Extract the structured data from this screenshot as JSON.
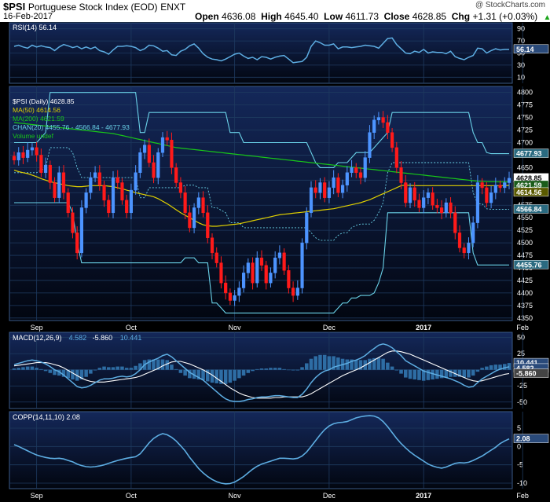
{
  "header": {
    "symbol": "$PSI",
    "name": "Portuguese Stock Index (EOD)",
    "exchange": "ENXT",
    "date": "16-Feb-2017",
    "watermark": "@ StockCharts.com",
    "open_label": "Open",
    "open": "4636.08",
    "high_label": "High",
    "high": "4645.40",
    "low_label": "Low",
    "low": "4611.73",
    "close_label": "Close",
    "close": "4628.85",
    "chg_label": "Chg",
    "chg": "+1.31 (+0.03%)"
  },
  "colors": {
    "background": "#000000",
    "panel": "#0a1433",
    "grid": "#1e3a5f",
    "up": "#4d94ff",
    "down": "#ff1a1a",
    "ma50": "#e0d000",
    "ma200": "#18c818",
    "channel": "#6ad2e8",
    "indicator": "#5dade2",
    "signal": "#ffffff"
  },
  "chart_data": [
    {
      "type": "line",
      "panel": "RSI",
      "legend": "RSI(14) 56.14",
      "y_ticks": [
        90,
        70,
        50,
        30,
        10
      ],
      "ylim": [
        0,
        100
      ],
      "last_value": "56.14",
      "values": [
        61,
        63,
        60,
        58,
        63,
        60,
        62,
        60,
        59,
        54,
        60,
        64,
        62,
        59,
        61,
        57,
        60,
        57,
        60,
        54,
        52,
        48,
        55,
        61,
        61,
        62,
        61,
        59,
        54,
        57,
        63,
        62,
        58,
        53,
        54,
        47,
        46,
        53,
        56,
        62,
        65,
        58,
        49,
        43,
        40,
        39,
        37,
        40,
        44,
        48,
        50,
        45,
        41,
        43,
        39,
        44,
        43,
        40,
        43,
        45,
        46,
        40,
        34,
        35,
        36,
        43,
        61,
        70,
        67,
        63,
        63,
        65,
        57,
        60,
        60,
        59,
        60,
        61,
        63,
        62,
        61,
        58,
        66,
        74,
        75,
        64,
        57,
        50,
        49,
        53,
        51,
        56,
        50,
        52,
        51,
        51,
        49,
        53,
        44,
        41,
        39,
        43,
        46,
        58,
        57,
        50,
        54,
        57,
        55,
        56,
        56
      ]
    },
    {
      "type": "candlestick",
      "panel": "price",
      "legend": [
        {
          "text": "$PSI (Daily) 4628.85",
          "color": "#ffffff"
        },
        {
          "text": "MA(50) 4614.56",
          "color": "#e0d000"
        },
        {
          "text": "MA(200) 4621.59",
          "color": "#18c818"
        },
        {
          "text": "CHAN(20) 4455.76 - 4566.84 - 4677.93",
          "color": "#6ad2e8"
        },
        {
          "text": "Volume undef",
          "color": "#18c818"
        }
      ],
      "y_ticks": [
        4800,
        4775,
        4750,
        4725,
        4700,
        4675,
        4650,
        4625,
        4600,
        4575,
        4550,
        4525,
        4500,
        4475,
        4450,
        4425,
        4400,
        4375,
        4350
      ],
      "ylim": [
        4345,
        4812
      ],
      "last_labels": [
        {
          "text": "4628.85",
          "value": 4628.85
        },
        {
          "text": "4621.59",
          "value": 4621.59
        },
        {
          "text": "4614.56",
          "value": 4614.56
        },
        {
          "text": "4677.93",
          "value": 4677.93
        },
        {
          "text": "4566.84",
          "value": 4566.84
        },
        {
          "text": "4455.76",
          "value": 4455.76
        }
      ],
      "x_labels": [
        {
          "label": "Sep",
          "index": 5
        },
        {
          "label": "Oct",
          "index": 26
        },
        {
          "label": "Nov",
          "index": 49
        },
        {
          "label": "Dec",
          "index": 70
        },
        {
          "label": "2017",
          "index": 91
        },
        {
          "label": "Feb",
          "index": 113
        }
      ],
      "close": [
        4665,
        4680,
        4670,
        4685,
        4690,
        4675,
        4640,
        4655,
        4620,
        4590,
        4640,
        4600,
        4560,
        4520,
        4480,
        4570,
        4600,
        4630,
        4640,
        4615,
        4585,
        4560,
        4630,
        4620,
        4585,
        4560,
        4605,
        4640,
        4680,
        4695,
        4660,
        4630,
        4680,
        4710,
        4705,
        4650,
        4620,
        4600,
        4560,
        4530,
        4570,
        4590,
        4560,
        4510,
        4480,
        4460,
        4420,
        4400,
        4385,
        4395,
        4410,
        4440,
        4460,
        4420,
        4470,
        4455,
        4420,
        4440,
        4470,
        4480,
        4445,
        4410,
        4395,
        4410,
        4500,
        4560,
        4610,
        4600,
        4620,
        4590,
        4610,
        4630,
        4600,
        4615,
        4640,
        4650,
        4640,
        4630,
        4670,
        4720,
        4745,
        4750,
        4740,
        4720,
        4690,
        4650,
        4620,
        4580,
        4610,
        4585,
        4570,
        4590,
        4600,
        4575,
        4570,
        4560,
        4580,
        4560,
        4520,
        4490,
        4480,
        4500,
        4540,
        4620,
        4610,
        4580,
        4600,
        4615,
        4610,
        4620,
        4628.85
      ],
      "ma50": [
        4645,
        4642,
        4640,
        4638,
        4635,
        4632,
        4628,
        4625,
        4622,
        4620,
        4618,
        4616,
        4614,
        4613,
        4612,
        4612,
        4613,
        4614,
        4614,
        4614,
        4614,
        4613,
        4612,
        4610,
        4608,
        4605,
        4603,
        4600,
        4598,
        4596,
        4594,
        4592,
        4588,
        4583,
        4578,
        4572,
        4566,
        4560,
        4555,
        4550,
        4545,
        4540,
        4536,
        4534,
        4533,
        4533,
        4534,
        4535,
        4536,
        4537,
        4538,
        4540,
        4542,
        4544,
        4546,
        4548,
        4550,
        4552,
        4554,
        4556,
        4557,
        4558,
        4559,
        4560,
        4561,
        4562,
        4563,
        4564,
        4565,
        4566,
        4567,
        4568,
        4570,
        4572,
        4574,
        4576,
        4578,
        4580,
        4583,
        4586,
        4590,
        4594,
        4598,
        4602,
        4606,
        4610,
        4614,
        4615,
        4614.56,
        4614,
        4614,
        4614,
        4614,
        4614,
        4614,
        4614,
        4614,
        4614,
        4614,
        4614,
        4614,
        4614,
        4614,
        4614,
        4614,
        4614,
        4614,
        4614,
        4614,
        4614,
        4614.56
      ],
      "ma200": [
        4740,
        4739,
        4738,
        4737,
        4736,
        4735,
        4734,
        4733,
        4732,
        4731,
        4730,
        4729,
        4728,
        4727,
        4726,
        4725,
        4724,
        4723,
        4722,
        4721,
        4720,
        4719,
        4718,
        4716,
        4714,
        4712,
        4710,
        4708,
        4706,
        4704,
        4702,
        4700,
        4698,
        4696,
        4694,
        4692,
        4690,
        4689,
        4688,
        4687,
        4686,
        4685,
        4684,
        4683,
        4682,
        4681,
        4680,
        4679,
        4678,
        4677,
        4676,
        4675,
        4674,
        4673,
        4672,
        4671,
        4670,
        4669,
        4668,
        4667,
        4666,
        4665,
        4664,
        4663,
        4662,
        4661,
        4660,
        4659,
        4658,
        4657,
        4656,
        4655,
        4654,
        4653,
        4652,
        4651,
        4650,
        4649,
        4648,
        4647,
        4646,
        4645,
        4644,
        4643,
        4642,
        4641,
        4640,
        4639,
        4638,
        4637,
        4636,
        4635,
        4634,
        4633,
        4632,
        4631,
        4630,
        4629,
        4628,
        4627,
        4626,
        4625,
        4624,
        4623,
        4622.5,
        4622,
        4621.8,
        4621.7,
        4621.6,
        4621.6,
        4621.59
      ],
      "chan_upper": [
        4700,
        4700,
        4700,
        4700,
        4700,
        4700,
        4710,
        4720,
        4800,
        4800,
        4800,
        4800,
        4800,
        4800,
        4800,
        4800,
        4800,
        4800,
        4800,
        4800,
        4800,
        4800,
        4800,
        4800,
        4800,
        4800,
        4800,
        4800,
        4720,
        4720,
        4760,
        4760,
        4760,
        4760,
        4760,
        4760,
        4760,
        4760,
        4760,
        4760,
        4760,
        4760,
        4760,
        4760,
        4760,
        4760,
        4760,
        4760,
        4720,
        4720,
        4720,
        4700,
        4700,
        4700,
        4700,
        4700,
        4700,
        4700,
        4700,
        4700,
        4700,
        4700,
        4700,
        4700,
        4700,
        4700,
        4680,
        4660,
        4650,
        4650,
        4650,
        4650,
        4660,
        4660,
        4660,
        4670,
        4680,
        4680,
        4680,
        4680,
        4690,
        4700,
        4710,
        4720,
        4760,
        4760,
        4760,
        4760,
        4760,
        4760,
        4760,
        4760,
        4760,
        4760,
        4760,
        4760,
        4760,
        4760,
        4760,
        4760,
        4760,
        4760,
        4720,
        4700,
        4700,
        4680,
        4677.93,
        4677.93,
        4677.93,
        4677.93,
        4677.93
      ],
      "chan_lower": [
        4580,
        4580,
        4580,
        4580,
        4580,
        4580,
        4580,
        4580,
        4580,
        4580,
        4580,
        4580,
        4580,
        4560,
        4500,
        4460,
        4460,
        4460,
        4460,
        4460,
        4460,
        4460,
        4460,
        4460,
        4460,
        4460,
        4460,
        4460,
        4460,
        4460,
        4460,
        4460,
        4460,
        4460,
        4460,
        4460,
        4460,
        4460,
        4470,
        4470,
        4470,
        4460,
        4460,
        4460,
        4380,
        4380,
        4370,
        4360,
        4360,
        4360,
        4360,
        4360,
        4360,
        4360,
        4360,
        4360,
        4360,
        4360,
        4360,
        4360,
        4360,
        4360,
        4360,
        4360,
        4360,
        4360,
        4360,
        4360,
        4360,
        4360,
        4360,
        4360,
        4370,
        4380,
        4380,
        4390,
        4390,
        4395,
        4395,
        4395,
        4400,
        4420,
        4450,
        4560,
        4560,
        4560,
        4560,
        4560,
        4560,
        4560,
        4560,
        4560,
        4560,
        4560,
        4560,
        4560,
        4560,
        4560,
        4560,
        4560,
        4560,
        4560,
        4480,
        4455.76,
        4455.76,
        4455.76,
        4455.76,
        4455.76,
        4455.76,
        4455.76,
        4455.76
      ]
    },
    {
      "type": "line",
      "panel": "MACD",
      "legend": [
        {
          "text": "MACD(12,26,9)",
          "color": "#ffffff"
        },
        {
          "text": "4.582",
          "color": "#5dade2"
        },
        {
          "text": "-5.860",
          "color": "#ffffff"
        },
        {
          "text": "10.441",
          "color": "#5dade2"
        }
      ],
      "y_ticks": [
        50,
        25,
        0,
        -25,
        -50
      ],
      "ylim": [
        -60,
        58
      ],
      "last_labels": [
        {
          "text": "10.441",
          "value": 10.441
        },
        {
          "text": "4.582",
          "value": 4.582
        },
        {
          "text": "-5.860",
          "value": -5.86
        }
      ],
      "macd": [
        8,
        10,
        12,
        14,
        15,
        14,
        12,
        9,
        5,
        0,
        -3,
        -8,
        -14,
        -20,
        -26,
        -28,
        -27,
        -24,
        -20,
        -16,
        -14,
        -14,
        -13,
        -11,
        -10,
        -11,
        -10,
        -6,
        0,
        8,
        12,
        15,
        18,
        22,
        24,
        20,
        14,
        8,
        2,
        -4,
        -8,
        -12,
        -16,
        -22,
        -28,
        -34,
        -40,
        -45,
        -48,
        -49,
        -49,
        -48,
        -46,
        -45,
        -43,
        -42,
        -42,
        -41,
        -40,
        -40,
        -41,
        -42,
        -43,
        -43,
        -38,
        -30,
        -20,
        -12,
        -6,
        -2,
        0,
        4,
        6,
        8,
        10,
        13,
        15,
        18,
        22,
        28,
        33,
        38,
        40,
        38,
        34,
        28,
        22,
        14,
        10,
        6,
        2,
        -2,
        -4,
        -6,
        -8,
        -10,
        -12,
        -14,
        -17,
        -20,
        -24,
        -27,
        -26,
        -20,
        -14,
        -10,
        -6,
        -2,
        1,
        3,
        4.582
      ],
      "signal": [
        6,
        7,
        8,
        9,
        10,
        11,
        11,
        11,
        10,
        8,
        6,
        3,
        -1,
        -5,
        -9,
        -13,
        -16,
        -18,
        -19,
        -19,
        -19,
        -18,
        -17,
        -16,
        -15,
        -14,
        -13,
        -12,
        -10,
        -7,
        -4,
        -1,
        2,
        6,
        9,
        12,
        13,
        13,
        11,
        9,
        6,
        3,
        0,
        -4,
        -8,
        -13,
        -18,
        -23,
        -28,
        -32,
        -36,
        -39,
        -41,
        -43,
        -44,
        -44,
        -44,
        -44,
        -43,
        -43,
        -42,
        -42,
        -42,
        -42,
        -42,
        -40,
        -37,
        -33,
        -29,
        -25,
        -21,
        -17,
        -13,
        -9,
        -6,
        -3,
        0,
        3,
        7,
        11,
        15,
        19,
        23,
        27,
        29,
        29,
        28,
        26,
        24,
        21,
        18,
        15,
        12,
        9,
        6,
        3,
        0,
        -3,
        -6,
        -9,
        -12,
        -15,
        -17,
        -18,
        -17,
        -15,
        -13,
        -11,
        -9,
        -7,
        -5.86
      ],
      "histogram": [
        2,
        3,
        4,
        5,
        5,
        3,
        1,
        -2,
        -5,
        -8,
        -9,
        -11,
        -13,
        -15,
        -17,
        -15,
        -11,
        -6,
        -1,
        3,
        5,
        4,
        4,
        5,
        5,
        3,
        3,
        6,
        10,
        15,
        16,
        16,
        16,
        16,
        15,
        8,
        1,
        -5,
        -9,
        -13,
        -14,
        -15,
        -16,
        -18,
        -20,
        -21,
        -22,
        -22,
        -20,
        -17,
        -13,
        -9,
        -5,
        -2,
        1,
        2,
        2,
        3,
        3,
        3,
        1,
        0,
        -1,
        -1,
        4,
        10,
        17,
        21,
        23,
        23,
        21,
        21,
        19,
        17,
        16,
        16,
        15,
        15,
        15,
        17,
        18,
        19,
        17,
        11,
        5,
        -1,
        -6,
        -12,
        -14,
        -15,
        -16,
        -17,
        -16,
        -15,
        -14,
        -13,
        -12,
        -11,
        -11,
        -11,
        -12,
        -12,
        -9,
        -3,
        3,
        5,
        7,
        8,
        8,
        9,
        10.441
      ]
    },
    {
      "type": "line",
      "panel": "COPP",
      "legend": "COPP(14,11,10) 2.08",
      "y_ticks": [
        5,
        0,
        -5,
        -10
      ],
      "ylim": [
        -11.5,
        9.5
      ],
      "last_value": "2.08",
      "values": [
        0.5,
        0,
        -0.6,
        -1.2,
        -1.8,
        -2.3,
        -2.7,
        -3,
        -3.2,
        -3.3,
        -3.2,
        -3.4,
        -3.8,
        -4.2,
        -4.8,
        -5.2,
        -5.5,
        -5.6,
        -5.5,
        -5.3,
        -5,
        -4.6,
        -4.2,
        -3.8,
        -3.5,
        -3.2,
        -3,
        -2.8,
        -2,
        -0.5,
        1,
        2.2,
        3,
        3.5,
        3.2,
        2.5,
        1.5,
        0.2,
        -1.2,
        -3,
        -4.5,
        -6,
        -7.2,
        -8.2,
        -9,
        -9.6,
        -10,
        -10.2,
        -10.1,
        -9.7,
        -9,
        -8.2,
        -7.2,
        -6.2,
        -5.4,
        -4.8,
        -4.4,
        -4,
        -3.6,
        -3.2,
        -3.2,
        -3.3,
        -3.4,
        -3.2,
        -2.6,
        -1.5,
        0,
        1.6,
        3.2,
        4.6,
        5.6,
        6.2,
        6.5,
        6.6,
        6.8,
        7.3,
        7.8,
        8.1,
        8.3,
        8.4,
        8.3,
        7.8,
        6.8,
        5.4,
        3.8,
        2.2,
        0.8,
        -0.4,
        -1.5,
        -2.4,
        -3.2,
        -4,
        -4.8,
        -5.3,
        -5.7,
        -5.9,
        -5.6,
        -5.1,
        -4.6,
        -4.4,
        -4.5,
        -4.3,
        -3.8,
        -3.2,
        -2.6,
        -1.8,
        -1,
        -0.2,
        0.8,
        1.5,
        2.08
      ]
    }
  ]
}
